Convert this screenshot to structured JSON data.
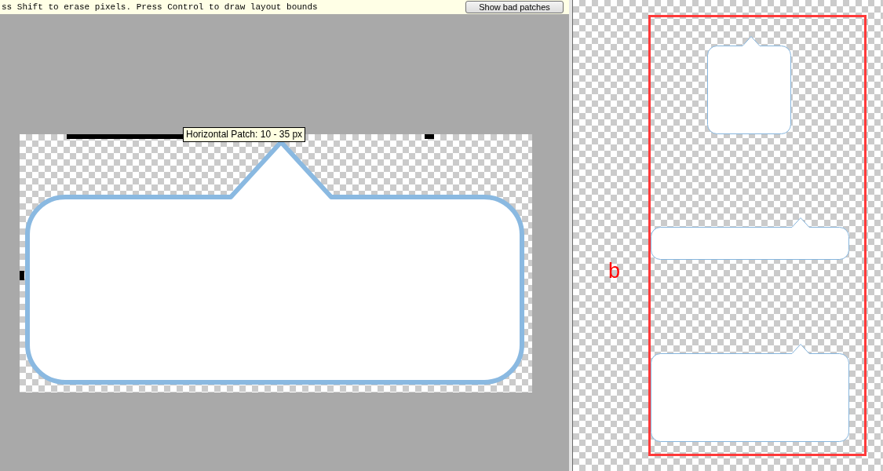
{
  "status_bar": {
    "hint": "ss Shift to erase pixels. Press Control to draw layout bounds",
    "button": "Show bad patches"
  },
  "editor": {
    "tooltip": "Horizontal Patch: 10 - 35 px"
  },
  "preview": {
    "label": "b"
  }
}
